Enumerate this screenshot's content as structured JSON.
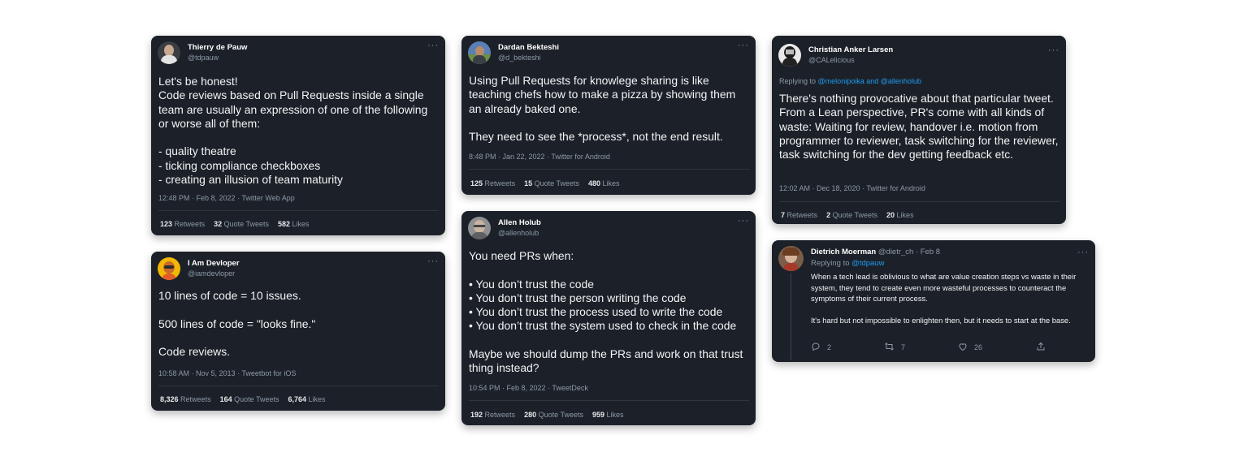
{
  "tweets": {
    "t1": {
      "name": "Thierry de Pauw",
      "handle": "@tdpauw",
      "text": "Let's be honest!\nCode reviews based on Pull Requests inside a single team are usually an expression of one of the following or worse all of them:\n\n- quality theatre\n- ticking compliance checkboxes\n- creating an illusion of team maturity",
      "meta": "12:48 PM · Feb 8, 2022 · Twitter Web App",
      "retweets": "123",
      "retweets_label": "Retweets",
      "quotes": "32",
      "quotes_label": "Quote Tweets",
      "likes": "582",
      "likes_label": "Likes"
    },
    "t2": {
      "name": "I Am Devloper",
      "handle": "@iamdevloper",
      "text": "10 lines of code = 10 issues.\n\n500 lines of code = \"looks fine.\"\n\nCode reviews.",
      "meta": "10:58 AM · Nov 5, 2013 · Tweetbot for iOS",
      "retweets": "8,326",
      "retweets_label": "Retweets",
      "quotes": "164",
      "quotes_label": "Quote Tweets",
      "likes": "6,764",
      "likes_label": "Likes"
    },
    "t3": {
      "name": "Dardan Bekteshi",
      "handle": "@d_bekteshi",
      "text": "Using Pull Requests for knowlege sharing is like teaching chefs how to make a pizza by showing them an already baked one.\n\nThey need to see the *process*, not the end result.",
      "meta": "8:48 PM · Jan 22, 2022 · Twitter for Android",
      "retweets": "125",
      "retweets_label": "Retweets",
      "quotes": "15",
      "quotes_label": "Quote Tweets",
      "likes": "480",
      "likes_label": "Likes"
    },
    "t4": {
      "name": "Allen Holub",
      "handle": "@allenholub",
      "text": "You need PRs when:\n\n• You don’t trust the code\n• You don’t trust the person writing the code\n• You don’t trust the process used to write the code\n• You don’t trust the system used to check in the code\n\nMaybe we should dump the PRs and work on that trust thing instead?",
      "meta": "10:54 PM · Feb 8, 2022 · TweetDeck",
      "retweets": "192",
      "retweets_label": "Retweets",
      "quotes": "280",
      "quotes_label": "Quote Tweets",
      "likes": "959",
      "likes_label": "Likes"
    },
    "t5": {
      "name": "Christian Anker Larsen",
      "handle": "@CALelicious",
      "replying_prefix": "Replying to",
      "replying_to": "@melonipoika and @allenholub",
      "text": "There's nothing provocative about that particular tweet. From a Lean perspective, PR's come with all kinds of waste: Waiting for review, handover i.e. motion from programmer to reviewer, task switching for the reviewer, task switching for the dev getting feedback etc.",
      "meta": "12:02 AM · Dec 18, 2020 · Twitter for Android",
      "retweets": "7",
      "retweets_label": "Retweets",
      "quotes": "2",
      "quotes_label": "Quote Tweets",
      "likes": "20",
      "likes_label": "Likes"
    },
    "t6": {
      "name": "Dietrich Moerman",
      "handle_time": "@dietr_ch · Feb 8",
      "replying_prefix": "Replying to",
      "replying_to": "@tdpauw",
      "text": "When a tech lead is oblivious to what are value creation steps vs waste in their system, they tend to create even more wasteful processes to counteract the symptoms of their current process.\n\nIt's hard but not impossible to enlighten then, but it needs to start at the base.",
      "replies": "2",
      "retweets": "7",
      "likes": "26"
    }
  },
  "icons": [
    "more-icon",
    "reply-icon",
    "retweet-icon",
    "like-icon",
    "share-icon"
  ],
  "more_glyph": "···"
}
